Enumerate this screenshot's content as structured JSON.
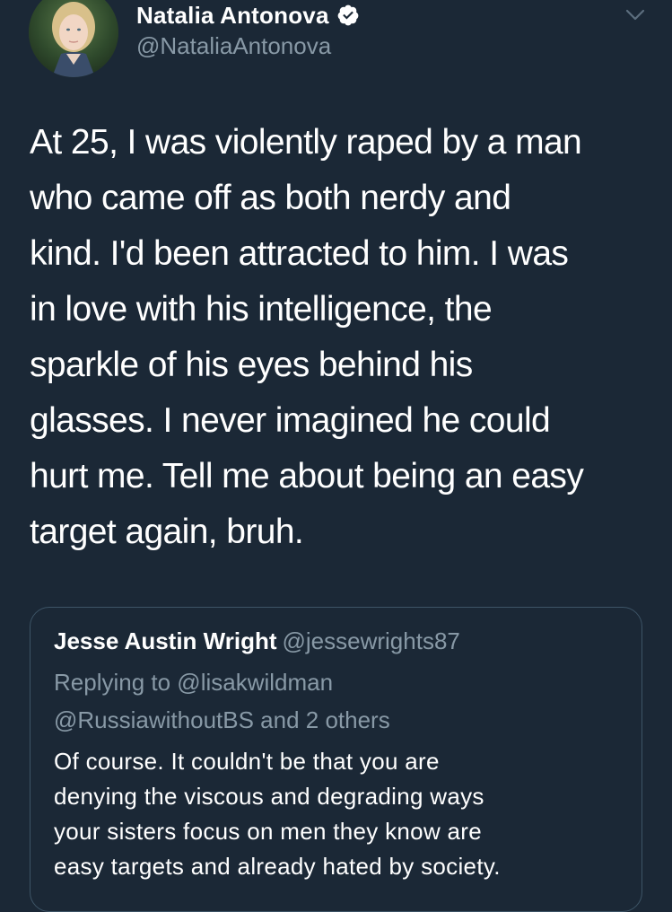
{
  "author": {
    "display_name": "Natalia Antonova",
    "handle": "@NataliaAntonova",
    "verified": true
  },
  "tweet": {
    "text_lines": [
      "At 25, I was violently raped by a man",
      "who came off as both nerdy and",
      "kind. I'd been attracted to him. I was",
      "in love with his intelligence, the",
      "sparkle of his eyes behind his",
      "glasses. I never imagined he could",
      "hurt me. Tell me about being an easy",
      "target again, bruh."
    ]
  },
  "quoted_tweet": {
    "display_name": "Jesse Austin Wright",
    "handle": "@jessewrights87",
    "reply_lines": [
      "Replying to @lisakwildman",
      "@RussiawithoutBS and 2 others"
    ],
    "text_lines": [
      "Of course. It couldn't be that you are",
      "denying the viscous and degrading ways",
      "your sisters focus on men they know are",
      "easy targets and already hated by society."
    ]
  },
  "colors": {
    "background": "#1b2836",
    "text_primary": "#ffffff",
    "text_secondary": "#8899a6",
    "verified_badge": "#ffffff",
    "card_border": "#3d5466"
  },
  "icons": {
    "verified": "verified-badge-icon",
    "menu": "chevron-down-icon"
  }
}
